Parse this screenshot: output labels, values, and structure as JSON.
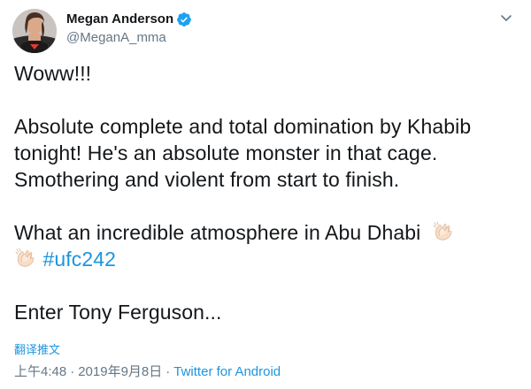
{
  "author": {
    "display_name": "Megan Anderson",
    "handle": "@MeganA_mma",
    "verified": true,
    "avatar_icon": "avatar-photo"
  },
  "menu": {
    "icon": "chevron-down-icon"
  },
  "tweet": {
    "line1": "Woww!!!",
    "line2": "Absolute complete and total domination by Khabib",
    "line3": "tonight! He's an absolute monster in that cage.",
    "line4": "Smothering and violent from start to finish.",
    "line5": "What an incredible atmosphere in Abu Dhabi",
    "hashtag": "#ufc242",
    "line7": "Enter Tony Ferguson..."
  },
  "actions": {
    "translate_label": "翻译推文"
  },
  "meta": {
    "time": "上午4:48",
    "separator": "·",
    "date": "2019年9月8日",
    "source": "Twitter for Android"
  },
  "colors": {
    "link": "#1b95e0",
    "secondary_text": "#657786",
    "verified_badge": "#1da1f2"
  }
}
